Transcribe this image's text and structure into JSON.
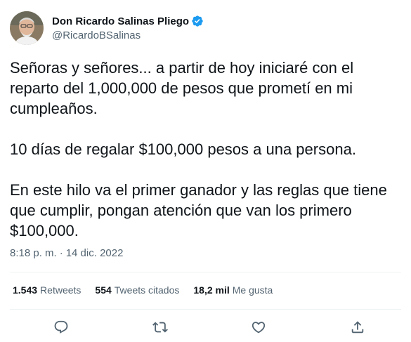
{
  "author": {
    "display_name": "Don Ricardo Salinas Pliego",
    "handle": "@RicardoBSalinas",
    "verified": true
  },
  "tweet": {
    "paragraphs": [
      "Señoras y señores... a partir de hoy iniciaré con el reparto del 1,000,000 de pesos que prometí en mi cumpleaños.",
      "10 días de regalar $100,000 pesos a una persona.",
      "En este hilo va el primer ganador y las reglas que tiene que cumplir, pongan atención que van los primero $100,000."
    ],
    "time": "8:18 p. m.",
    "separator": "·",
    "date": "14 dic. 2022"
  },
  "stats": {
    "retweets_count": "1.543",
    "retweets_label": "Retweets",
    "quotes_count": "554",
    "quotes_label": "Tweets citados",
    "likes_count": "18,2 mil",
    "likes_label": "Me gusta"
  },
  "actions": {
    "reply_icon": "reply-icon",
    "retweet_icon": "retweet-icon",
    "like_icon": "heart-icon",
    "share_icon": "share-icon"
  },
  "colors": {
    "text": "#0f1419",
    "secondary": "#536471",
    "verified": "#1d9bf0",
    "divider": "#eff3f4"
  }
}
